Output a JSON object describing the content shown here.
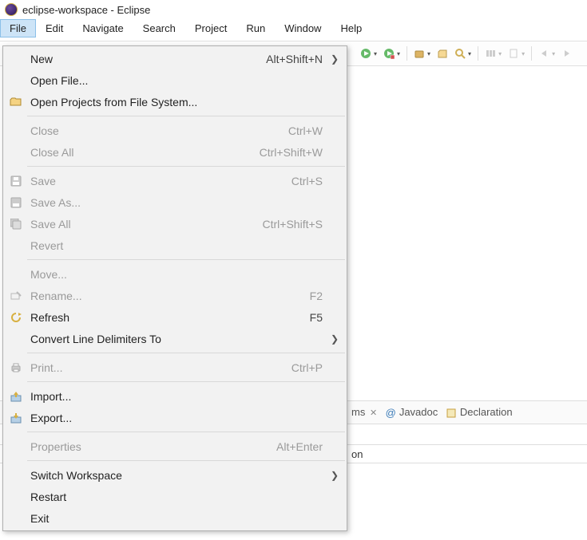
{
  "window": {
    "title": "eclipse-workspace - Eclipse"
  },
  "menubar": {
    "items": [
      "File",
      "Edit",
      "Navigate",
      "Search",
      "Project",
      "Run",
      "Window",
      "Help"
    ]
  },
  "file_menu": {
    "new": {
      "label": "New",
      "accel": "Alt+Shift+N",
      "submenu": true
    },
    "open_file": {
      "label": "Open File..."
    },
    "open_projects": {
      "label": "Open Projects from File System..."
    },
    "close": {
      "label": "Close",
      "accel": "Ctrl+W",
      "disabled": true
    },
    "close_all": {
      "label": "Close All",
      "accel": "Ctrl+Shift+W",
      "disabled": true
    },
    "save": {
      "label": "Save",
      "accel": "Ctrl+S",
      "disabled": true
    },
    "save_as": {
      "label": "Save As...",
      "disabled": true
    },
    "save_all": {
      "label": "Save All",
      "accel": "Ctrl+Shift+S",
      "disabled": true
    },
    "revert": {
      "label": "Revert",
      "disabled": true
    },
    "move": {
      "label": "Move...",
      "disabled": true
    },
    "rename": {
      "label": "Rename...",
      "accel": "F2",
      "disabled": true
    },
    "refresh": {
      "label": "Refresh",
      "accel": "F5"
    },
    "convert": {
      "label": "Convert Line Delimiters To",
      "submenu": true
    },
    "print": {
      "label": "Print...",
      "accel": "Ctrl+P",
      "disabled": true
    },
    "import": {
      "label": "Import..."
    },
    "export": {
      "label": "Export..."
    },
    "properties": {
      "label": "Properties",
      "accel": "Alt+Enter",
      "disabled": true
    },
    "switch_ws": {
      "label": "Switch Workspace",
      "submenu": true
    },
    "restart": {
      "label": "Restart"
    },
    "exit": {
      "label": "Exit"
    }
  },
  "bottom_tabs": {
    "problems": "ms",
    "javadoc": "Javadoc",
    "declaration": "Declaration"
  },
  "columns": {
    "col1": "on"
  }
}
